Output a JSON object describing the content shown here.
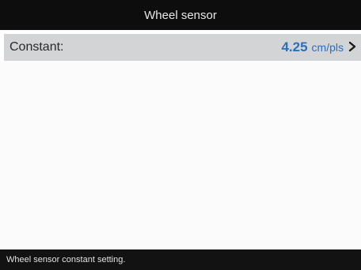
{
  "header": {
    "title": "Wheel sensor"
  },
  "setting": {
    "label": "Constant:",
    "value": "4.25",
    "unit": "cm/pls"
  },
  "status": {
    "text": "Wheel sensor constant setting."
  },
  "icons": {
    "row_arrow": "chevron-right-icon"
  },
  "colors": {
    "value_accent": "#2a6fbf",
    "header_bg": "#0d0d0d",
    "row_bg": "#d3d4d6"
  }
}
